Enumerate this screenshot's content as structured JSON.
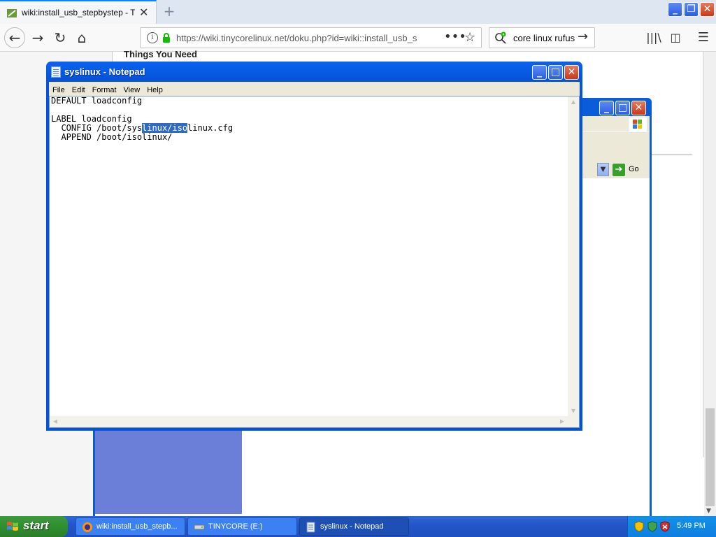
{
  "browser": {
    "tab_title": "wiki:install_usb_stepbystep - Tiny",
    "new_tab": "+",
    "url": "https://wiki.tinycorelinux.net/doku.php?id=wiki::install_usb_s",
    "search_text": "core linux rufus"
  },
  "page": {
    "heading": "Things You Need"
  },
  "bg_window": {
    "go_label": "Go"
  },
  "notepad": {
    "title": "syslinux - Notepad",
    "menu": [
      "File",
      "Edit",
      "Format",
      "View",
      "Help"
    ],
    "lines": {
      "l1": "DEFAULT loadconfig",
      "l2": "",
      "l3": "LABEL loadconfig",
      "l4_pre": "  CONFIG /boot/sys",
      "l4_sel": "linux/iso",
      "l4_post": "linux.cfg",
      "l5": "  APPEND /boot/isolinux/"
    }
  },
  "taskbar": {
    "start_label": "start",
    "items": [
      {
        "label": "wiki:install_usb_stepb..."
      },
      {
        "label": "TINYCORE (E:)"
      },
      {
        "label": "syslinux - Notepad"
      }
    ],
    "clock": "5:49 PM"
  },
  "colors": {
    "xp_blue": "#0553d6",
    "selection": "#316ac5",
    "start_green": "#3c9a3c"
  }
}
